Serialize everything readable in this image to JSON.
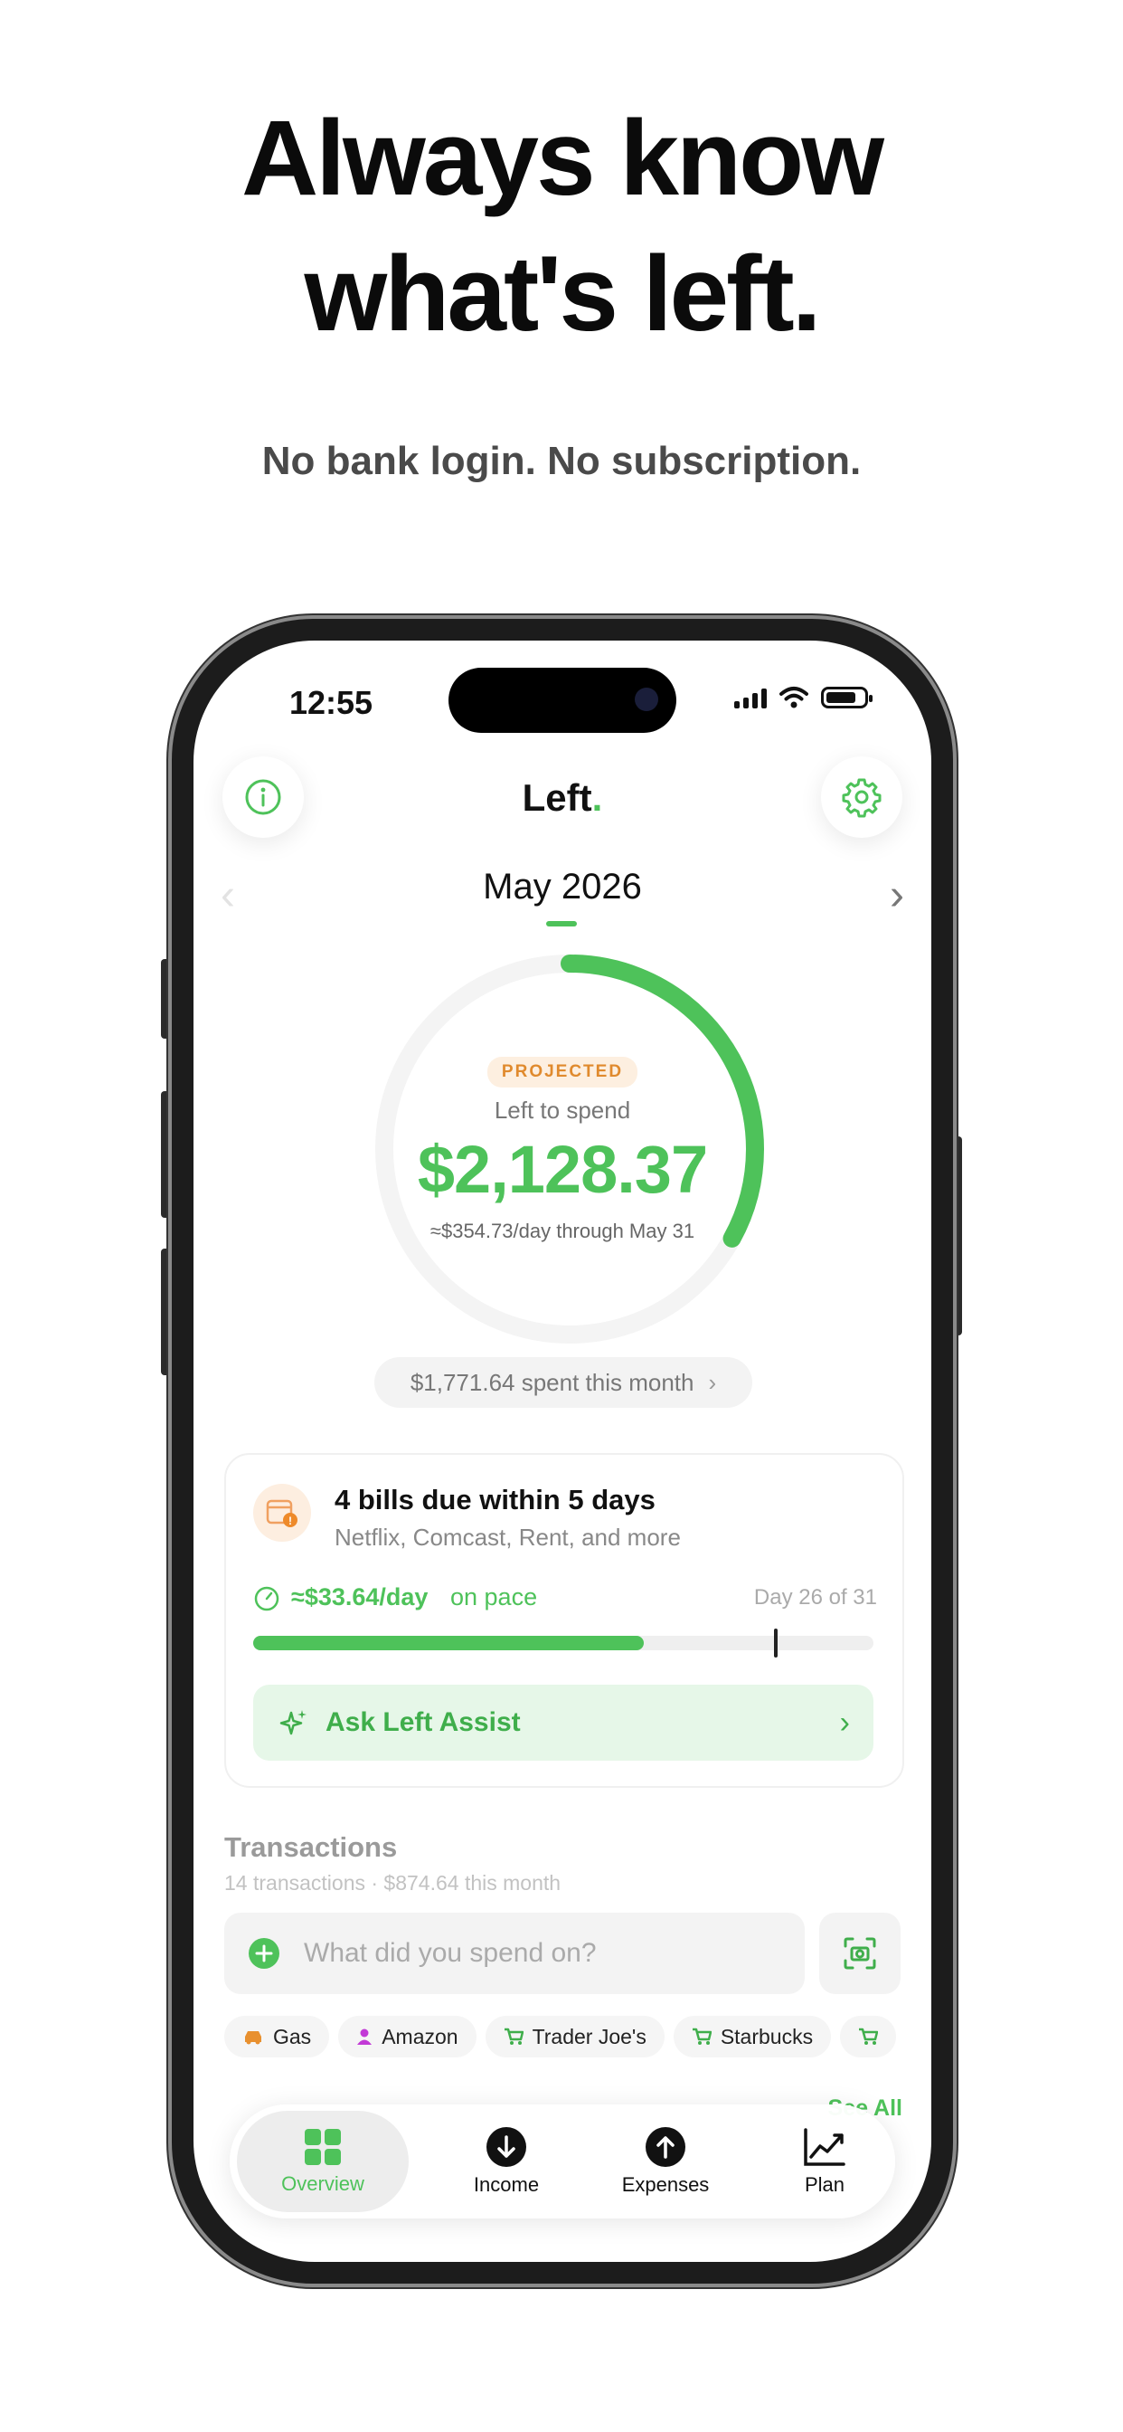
{
  "headline": {
    "line1": "Always know",
    "line2": "what's left."
  },
  "subheadline": "No bank login. No subscription.",
  "status_bar": {
    "time": "12:55"
  },
  "app": {
    "name": "Left",
    "name_dot": "."
  },
  "month": {
    "label": "May 2026"
  },
  "summary": {
    "badge": "PROJECTED",
    "label": "Left to spend",
    "amount": "$2,128.37",
    "per_day": "≈$354.73/day through May 31",
    "ring_progress_fraction": 0.33,
    "spent_text": "$1,771.64 spent this month"
  },
  "bills_card": {
    "title": "4 bills due within 5 days",
    "subtitle": "Netflix, Comcast, Rent, and more",
    "pace_amount": "≈$33.64/day",
    "pace_label": "on pace",
    "day_label": "Day 26 of 31",
    "progress_fraction": 0.63,
    "marker_fraction": 0.84,
    "assist_label": "Ask Left Assist"
  },
  "transactions": {
    "title": "Transactions",
    "subtitle": "14 transactions · $874.64 this month",
    "search_placeholder": "What did you spend on?",
    "chips": [
      {
        "label": "Gas",
        "icon": "car-icon",
        "color": "#e8902f"
      },
      {
        "label": "Amazon",
        "icon": "person-icon",
        "color": "#c23ad6"
      },
      {
        "label": "Trader Joe's",
        "icon": "cart-icon",
        "color": "#3fae4b"
      },
      {
        "label": "Starbucks",
        "icon": "cart-icon",
        "color": "#3fae4b"
      },
      {
        "label": "",
        "icon": "cart-icon",
        "color": "#3fae4b"
      }
    ],
    "see_all": "See All"
  },
  "tabbar": {
    "tabs": [
      {
        "label": "Overview",
        "icon": "grid-icon",
        "active": true
      },
      {
        "label": "Income",
        "icon": "arrow-down-circle-icon",
        "active": false
      },
      {
        "label": "Expenses",
        "icon": "arrow-up-circle-icon",
        "active": false
      },
      {
        "label": "Plan",
        "icon": "chart-line-icon",
        "active": false
      }
    ]
  },
  "colors": {
    "accent": "#4ec25a",
    "warning": "#e08a2d"
  }
}
